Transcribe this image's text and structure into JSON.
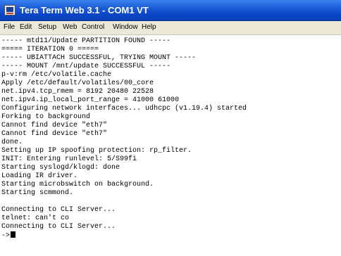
{
  "window": {
    "title": "Tera Term Web 3.1 - COM1 VT"
  },
  "menu": [
    {
      "label": "File"
    },
    {
      "label": "Edit"
    },
    {
      "label": "Setup"
    },
    {
      "label": "Web"
    },
    {
      "label": "Control"
    },
    {
      "label": "Window"
    },
    {
      "label": "Help"
    }
  ],
  "terminal": {
    "lines": [
      "----- mtd11/Update PARTITION FOUND -----",
      "===== ITERATION 0 =====",
      "----- UBIATTACH SUCCESSFUL, TRYING MOUNT -----",
      "----- MOUNT /mnt/update SUCCESSFUL -----",
      "p-v:rm /etc/volatile.cache",
      "Apply /etc/default/volatiles/00_core",
      "net.ipv4.tcp_rmem = 8192 20480 22528",
      "net.ipv4.ip_local_port_range = 41000 61000",
      "Configuring network interfaces... udhcpc (v1.19.4) started",
      "Forking to background",
      "Cannot find device \"eth7\"",
      "Cannot find device \"eth7\"",
      "done.",
      "Setting up IP spoofing protection: rp_filter.",
      "INIT: Entering runlevel: 5/S99fi",
      "Starting syslogd/klogd: done",
      "Loading IR driver.",
      "Starting microbswitch on background.",
      "Starting scmmond.",
      "",
      "Connecting to CLI Server...",
      "telnet: can't co",
      "Connecting to CLI Server...",
      "->"
    ]
  }
}
